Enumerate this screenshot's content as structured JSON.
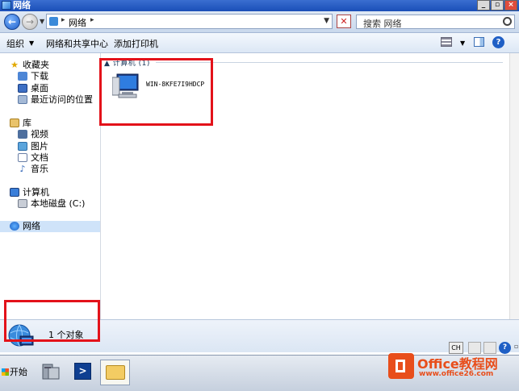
{
  "window": {
    "title": "网络"
  },
  "address": {
    "path": "网络",
    "sep": "▸"
  },
  "search": {
    "placeholder": "搜索 网络"
  },
  "toolbar": {
    "organize": "组织",
    "network_center": "网络和共享中心",
    "add_printer": "添加打印机"
  },
  "sidebar": {
    "favorites": "收藏夹",
    "downloads": "下载",
    "desktop": "桌面",
    "recent": "最近访问的位置",
    "libraries": "库",
    "videos": "视频",
    "pictures": "图片",
    "documents": "文档",
    "music": "音乐",
    "computer": "计算机",
    "local_disk": "本地磁盘 (C:)",
    "network": "网络"
  },
  "content": {
    "group_header": "计算机 (1)",
    "computer_name": "WIN-8KFE7I9HDCP"
  },
  "details": {
    "count": "1 个对象"
  },
  "lang": {
    "ch": "CH"
  },
  "taskbar": {
    "start": "开始"
  },
  "watermark": {
    "title": "Office教程网",
    "url": "www.office26.com"
  },
  "colors": {
    "highlight": "#e3121a",
    "titlebar": "#1a4fb8"
  }
}
